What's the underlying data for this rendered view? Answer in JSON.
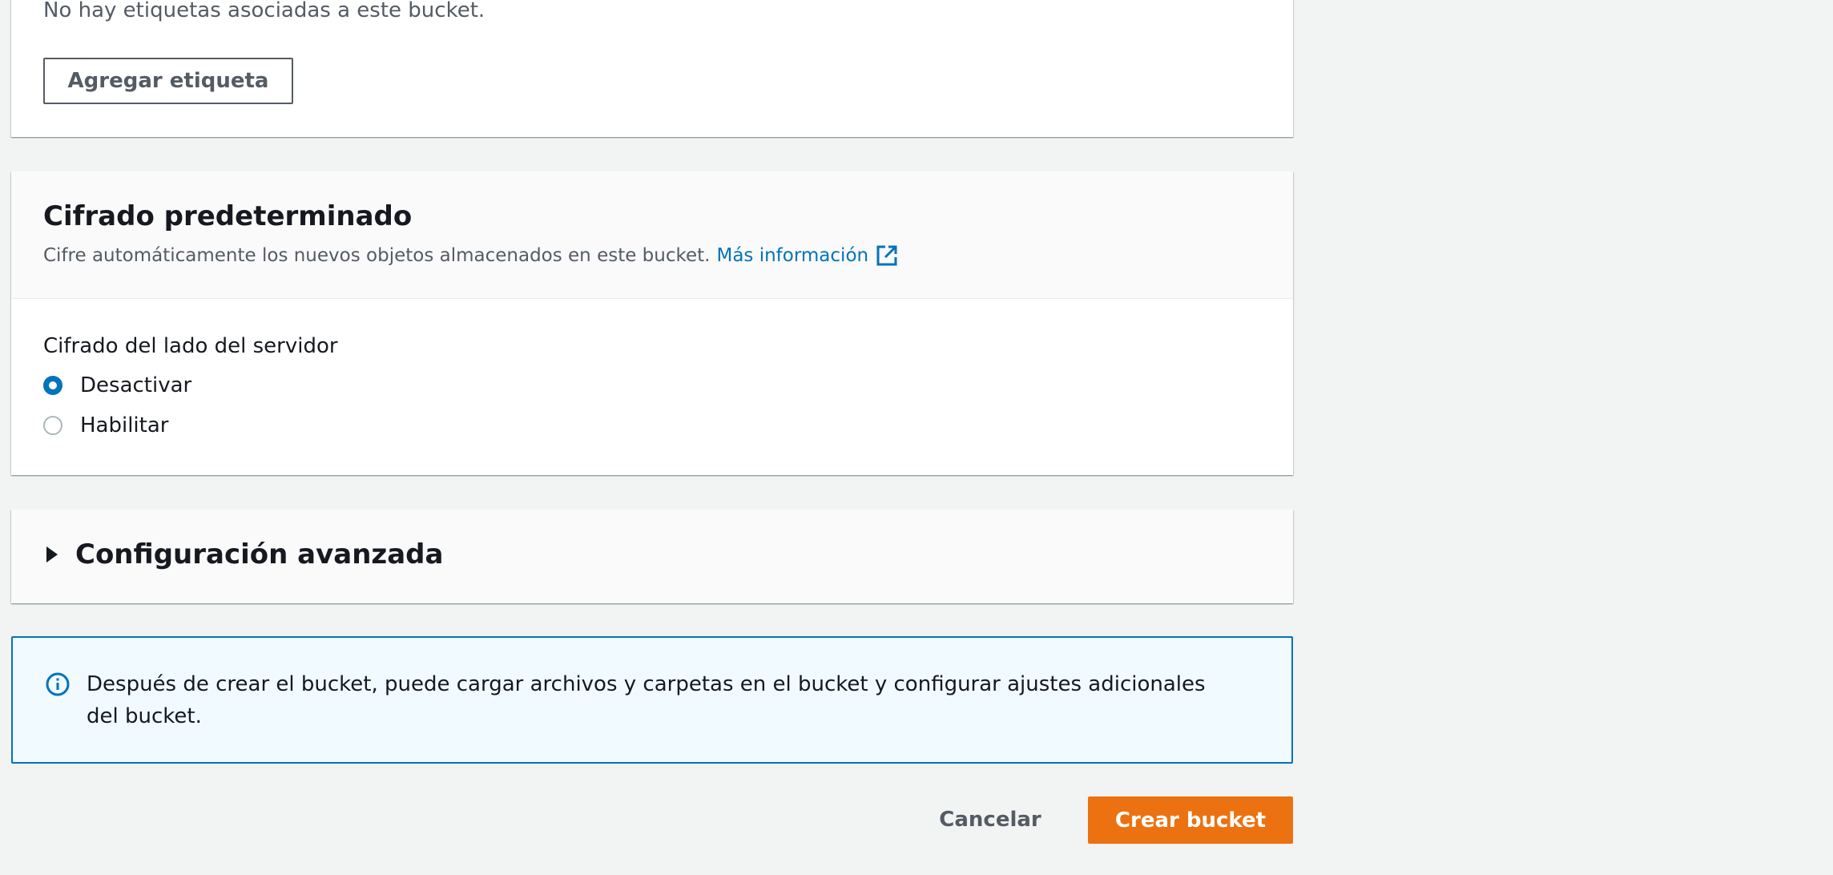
{
  "tags": {
    "empty_message": "No hay etiquetas asociadas a este bucket.",
    "add_button": "Agregar etiqueta"
  },
  "encryption": {
    "title": "Cifrado predeterminado",
    "description": "Cifre automáticamente los nuevos objetos almacenados en este bucket.",
    "learn_more": "Más información",
    "learn_more_icon": "external-link-icon",
    "field_label": "Cifrado del lado del servidor",
    "options": [
      {
        "label": "Desactivar",
        "selected": true
      },
      {
        "label": "Habilitar",
        "selected": false
      }
    ]
  },
  "advanced": {
    "title": "Configuración avanzada",
    "expanded": false,
    "icon": "caret-right-icon"
  },
  "info_alert": {
    "icon": "info-icon",
    "text": "Después de crear el bucket, puede cargar archivos y carpetas en el bucket y configurar ajustes adicionales del bucket."
  },
  "footer": {
    "cancel_label": "Cancelar",
    "create_label": "Crear bucket"
  },
  "colors": {
    "background": "#f2f3f3",
    "link": "#0073bb",
    "primary_button": "#ec7211",
    "info_border": "#0073bb",
    "info_background": "#f1faff"
  }
}
